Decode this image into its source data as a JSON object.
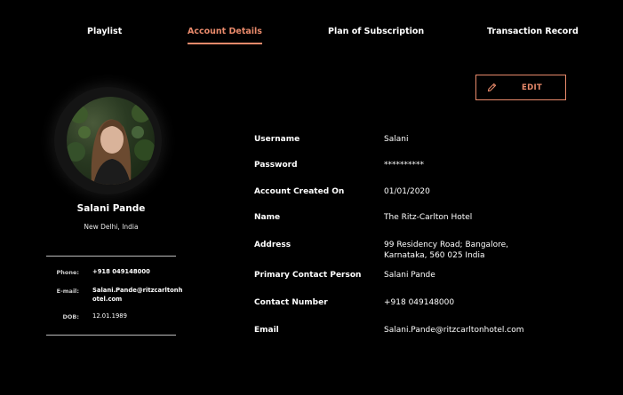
{
  "tabs": [
    {
      "label": "Playlist"
    },
    {
      "label": "Account Details"
    },
    {
      "label": "Plan of Subscription"
    },
    {
      "label": "Transaction Record"
    }
  ],
  "active_tab": "Account Details",
  "accent_color": "#e98a6b",
  "edit_button": {
    "label": "EDIT",
    "icon": "pencil-icon"
  },
  "profile": {
    "name": "Salani Pande",
    "location": "New Delhi, India",
    "contacts": [
      {
        "label": "Phone:",
        "value": "+918 049148000"
      },
      {
        "label": "E-mail:",
        "value_line1": "Salani.Pande@ritzcarltonh",
        "value_line2": "otel.com"
      },
      {
        "label": "DOB:",
        "value": "12.01.1989"
      }
    ]
  },
  "details": [
    {
      "label": "Username",
      "value": "Salani"
    },
    {
      "label": "Password",
      "value": "**********"
    },
    {
      "label": "Account Created On",
      "value": "01/01/2020"
    },
    {
      "label": "Name",
      "value": "The Ritz-Carlton Hotel"
    },
    {
      "label": "Address",
      "value_line1": "99 Residency Road; Bangalore,",
      "value_line2": "Karnataka, 560 025 India"
    },
    {
      "label": "Primary Contact Person",
      "value": "Salani Pande"
    },
    {
      "label": "Contact Number",
      "value": "+918 049148000"
    },
    {
      "label": "Email",
      "value": "Salani.Pande@ritzcarltonhotel.com"
    }
  ]
}
